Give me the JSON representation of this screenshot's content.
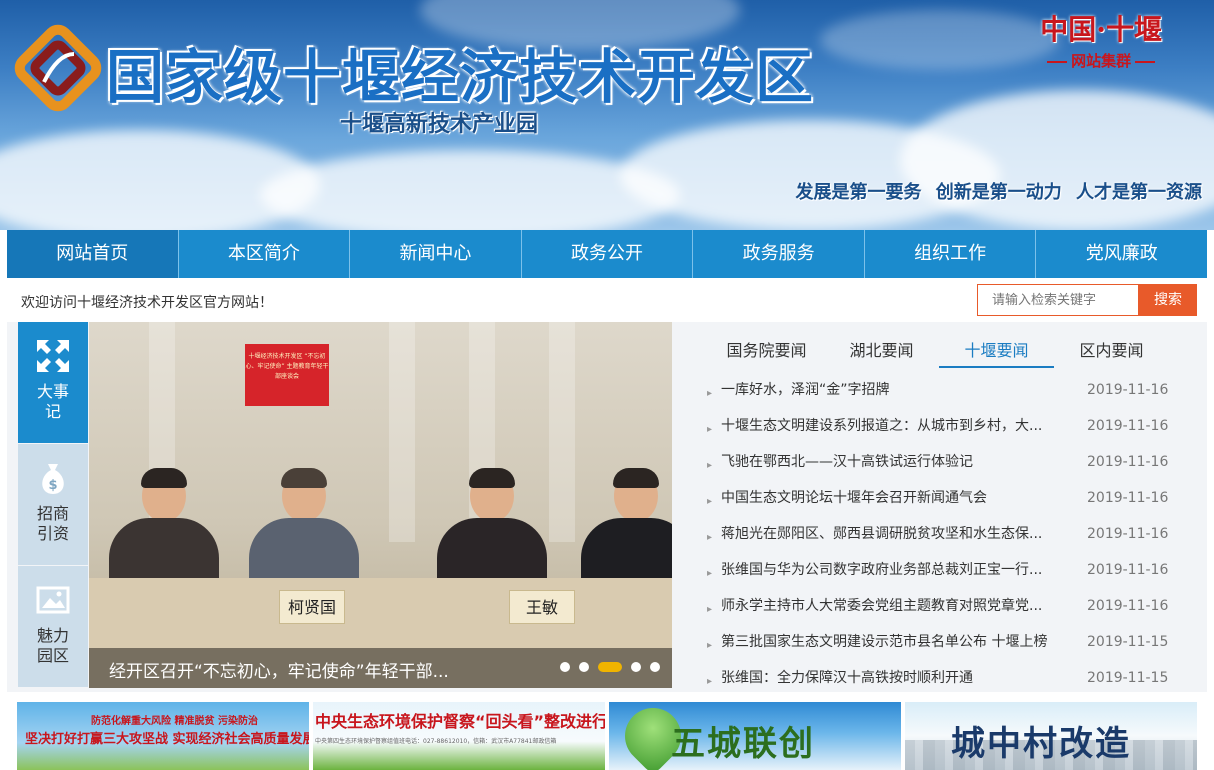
{
  "header": {
    "site_title": "国家级十堰经济技术开发区",
    "subtitle": "十堰高新技术产业园",
    "group_badge": {
      "title": "中国·十堰",
      "subtitle": "网站集群"
    },
    "slogan": "发展是第一要务  创新是第一动力  人才是第一资源"
  },
  "nav": {
    "items": [
      {
        "label": "网站首页"
      },
      {
        "label": "本区简介"
      },
      {
        "label": "新闻中心"
      },
      {
        "label": "政务公开"
      },
      {
        "label": "政务服务"
      },
      {
        "label": "组织工作"
      },
      {
        "label": "党风廉政"
      }
    ],
    "active_index": 0
  },
  "welcome_text": "欢迎访问十堰经济技术开发区官方网站！",
  "search": {
    "placeholder": "请输入检索关键字",
    "button_label": "搜索"
  },
  "quick_links": [
    {
      "label": "大事记",
      "icon": "expand-arrows-icon"
    },
    {
      "label": "招商引资",
      "icon": "money-bag-icon"
    },
    {
      "label": "魅力园区",
      "icon": "picture-icon"
    }
  ],
  "slider": {
    "caption": "经开区召开“不忘初心，牢记使命”年轻干部...",
    "dot_count": 5,
    "active_dot": 2,
    "photo": {
      "banner_text": "十堰经济技术开发区 “不忘初心、牢记使命” 主题教育年轻干部座谈会",
      "nameplates": [
        "柯贤国",
        "王敏"
      ]
    }
  },
  "news": {
    "tabs": [
      {
        "label": "国务院要闻"
      },
      {
        "label": "湖北要闻"
      },
      {
        "label": "十堰要闻"
      },
      {
        "label": "区内要闻"
      }
    ],
    "active_tab": 2,
    "items": [
      {
        "title": "一库好水，泽润“金”字招牌",
        "date": "2019-11-16"
      },
      {
        "title": "十堰生态文明建设系列报道之：从城市到乡村，大...",
        "date": "2019-11-16"
      },
      {
        "title": "飞驰在鄂西北——汉十高铁试运行体验记",
        "date": "2019-11-16"
      },
      {
        "title": "中国生态文明论坛十堰年会召开新闻通气会",
        "date": "2019-11-16"
      },
      {
        "title": "蒋旭光在郧阳区、郧西县调研脱贫攻坚和水生态保...",
        "date": "2019-11-16"
      },
      {
        "title": "张维国与华为公司数字政府业务部总裁刘正宝一行...",
        "date": "2019-11-16"
      },
      {
        "title": "师永学主持市人大常委会党组主题教育对照党章党...",
        "date": "2019-11-16"
      },
      {
        "title": "第三批国家生态文明建设示范市县名单公布 十堰上榜",
        "date": "2019-11-15"
      },
      {
        "title": "张维国：全力保障汉十高铁按时顺利开通",
        "date": "2019-11-15"
      }
    ]
  },
  "banners": [
    {
      "line1": "防范化解重大风险  精准脱贫  污染防治",
      "line2": "坚决打好打赢三大攻坚战  实现经济社会高质量发展"
    },
    {
      "line1": "中央生态环境保护督察“回头看”整改进行时",
      "line2": "中央第四生态环境保护督察组值班电话：027-88612010，信箱：武汉市A77841邮政信箱"
    },
    {
      "line1": "五城联创"
    },
    {
      "line1": "城中村改造"
    }
  ],
  "colors": {
    "nav_bg": "#1b8bcd",
    "accent_orange": "#e85a2a",
    "badge_red": "#c8161d",
    "tab_active": "#1b7cc2",
    "dot_active": "#f0b400"
  }
}
